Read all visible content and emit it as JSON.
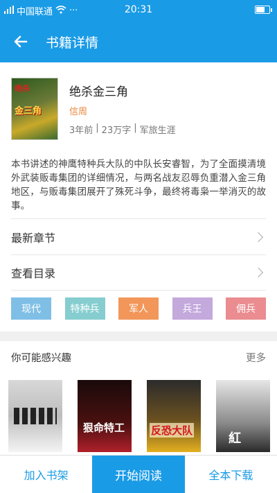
{
  "status_bar": {
    "carrier": "中国联通",
    "time": "20:31"
  },
  "header": {
    "title": "书籍详情"
  },
  "book": {
    "title": "绝杀金三角",
    "author": "信周",
    "meta": [
      "3年前",
      "|",
      "23万字",
      "|",
      "军旅生涯"
    ],
    "cover_text": "金三角",
    "cover_small_text": "绝杀"
  },
  "intro": "本书讲述的神鹰特种兵大队的中队长安睿智，为了全面摸清境外武装贩毒集团的详细情况，与两名战友忍辱负重潜入金三角地区，与贩毒集团展开了殊死斗争，最终将毒枭一举消灭的故事。",
  "rows": {
    "latest": "最新章节",
    "catalog": "查看目录"
  },
  "tags": [
    {
      "label": "现代",
      "color": "#7fbfe6"
    },
    {
      "label": "特种兵",
      "color": "#86cdd0"
    },
    {
      "label": "军人",
      "color": "#f2965a"
    },
    {
      "label": "兵王",
      "color": "#c4a9dc"
    },
    {
      "label": "佣兵",
      "color": "#ea8c90"
    }
  ],
  "recommend": {
    "title": "你可能感兴趣",
    "more": "更多",
    "covers": [
      {
        "text": ""
      },
      {
        "text": "狠命特工"
      },
      {
        "text": "反恐大队"
      },
      {
        "text": "紅"
      }
    ]
  },
  "bottom": {
    "add_shelf": "加入书架",
    "start_read": "开始阅读",
    "download_all": "全本下载"
  },
  "accent": "#1a9be6"
}
